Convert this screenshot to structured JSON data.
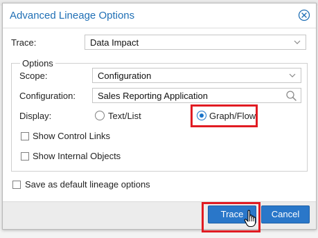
{
  "dialog": {
    "title": "Advanced Lineage Options"
  },
  "trace": {
    "label": "Trace:",
    "value": "Data Impact"
  },
  "options": {
    "legend": "Options",
    "scope_label": "Scope:",
    "scope_value": "Configuration",
    "configuration_label": "Configuration:",
    "configuration_value": "Sales Reporting Application",
    "display_label": "Display:",
    "display_options": [
      {
        "label": "Text/List",
        "selected": false
      },
      {
        "label": "Graph/Flow",
        "selected": true
      }
    ],
    "show_control_links": {
      "label": "Show Control Links",
      "checked": false
    },
    "show_internal_objects": {
      "label": "Show Internal Objects",
      "checked": false
    }
  },
  "save_default": {
    "label": "Save as default lineage options",
    "checked": false
  },
  "buttons": {
    "trace": "Trace",
    "cancel": "Cancel"
  },
  "colors": {
    "accent": "#1f6fb5",
    "button": "#2a77c9",
    "highlight": "#e11b22"
  }
}
